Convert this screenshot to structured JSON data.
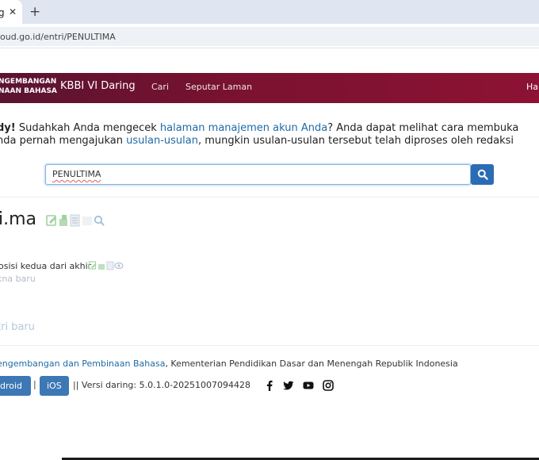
{
  "browser": {
    "tab_title": "g",
    "tab_close": "✕",
    "new_tab": "+",
    "url": "oud.go.id/entri/PENULTIMA"
  },
  "navbar": {
    "logo_line1": "NGEMBANGAN",
    "logo_line2": "NAAN BAHASA",
    "brand": "KBBI VI Daring",
    "items": [
      "Cari",
      "Seputar Laman"
    ],
    "right_item": "Hal"
  },
  "notice": {
    "line1_prefix_bold": "dy!",
    "line1_text1": " Sudahkah Anda mengecek ",
    "line1_link": "halaman manajemen akun Anda",
    "line1_text2": "? Anda dapat melihat cara membuka",
    "line2_text1": "nda pernah mengajukan ",
    "line2_link": "usulan-usulan",
    "line2_text2": ", mungkin usulan-usulan tersebut telah diproses oleh redaksi"
  },
  "search": {
    "value": "PENULTIMA"
  },
  "entry": {
    "title": "i.ma",
    "definition": "osisi kedua dari akhir",
    "new_subentry": "kna baru",
    "new_entry": "tri baru"
  },
  "footer": {
    "org_link": "engembangan dan Pembinaan Bahasa",
    "org_text": ", Kementerian Pendidikan Dasar dan Menengah Republik Indonesia",
    "android_label": "droid",
    "separator": "|",
    "ios_label": "iOS",
    "version": "|| Versi daring: 5.0.1.0-20251007094428"
  },
  "icons": {
    "search": "search-icon",
    "edit": "edit-icon",
    "social": [
      "facebook-icon",
      "twitter-icon",
      "youtube-icon",
      "instagram-icon"
    ]
  },
  "colors": {
    "navbar": "#7a1230",
    "link": "#1f6aa5",
    "button": "#3d78b5",
    "search_button": "#2b6db4"
  }
}
